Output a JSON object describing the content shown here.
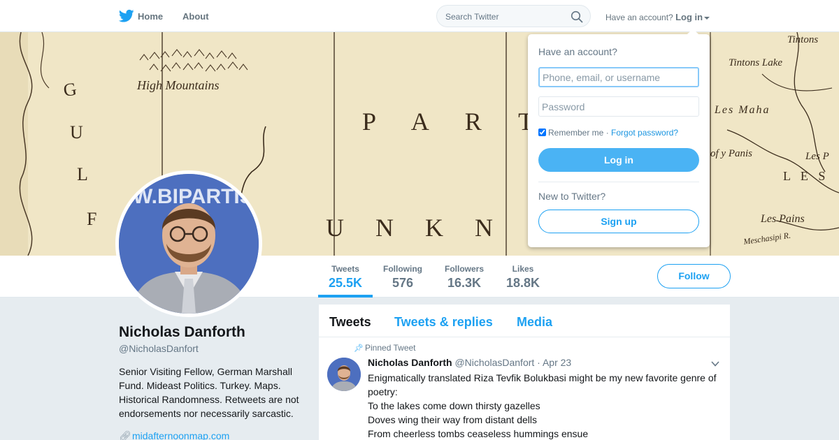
{
  "nav": {
    "logo_icon": "twitter-bird-icon",
    "home_label": "Home",
    "about_label": "About",
    "search_placeholder": "Search Twitter",
    "have_account_text": "Have an account?",
    "login_label": "Log in"
  },
  "banner": {
    "map_labels": [
      "High Mountains",
      "P A R T",
      "U N K N",
      "G",
      "U",
      "L",
      "F",
      "Tintons",
      "Tintons Lake",
      "Les Maha",
      "of y Panis",
      "Les P",
      "L E S",
      "Les Pains",
      "Meschasipi R."
    ]
  },
  "profile_nav": {
    "stats": [
      {
        "label": "Tweets",
        "value": "25.5K"
      },
      {
        "label": "Following",
        "value": "576"
      },
      {
        "label": "Followers",
        "value": "16.3K"
      },
      {
        "label": "Likes",
        "value": "18.8K"
      }
    ],
    "follow_label": "Follow"
  },
  "profile": {
    "name": "Nicholas Danforth",
    "handle": "@NicholasDanfort",
    "bio": "Senior Visiting Fellow, German Marshall Fund. Mideast Politics. Turkey. Maps. Historical Randomness. Retweets are not endorsements nor necessarily sarcastic.",
    "link": "midafternoonmap.com",
    "avatar_backdrop_text": "W.BIPARTIS"
  },
  "timeline": {
    "tabs": [
      "Tweets",
      "Tweets & replies",
      "Media"
    ],
    "pinned_label": "Pinned Tweet",
    "tweet": {
      "name": "Nicholas Danforth",
      "handle": "@NicholasDanfort",
      "date": "· Apr 23",
      "lines": [
        "Enigmatically translated Riza Tevfik Bolukbasi might be my new favorite genre of",
        "poetry:",
        "To the lakes come down thirsty gazelles",
        "Doves wing their way from distant dells",
        "From cheerless tombs ceaseless hummings ensue"
      ]
    }
  },
  "login_dropdown": {
    "header": "Have an account?",
    "username_placeholder": "Phone, email, or username",
    "password_placeholder": "Password",
    "remember_label": "Remember me ·",
    "forgot_label": "Forgot password?",
    "login_button": "Log in",
    "new_text": "New to Twitter?",
    "signup_button": "Sign up"
  },
  "colors": {
    "accent": "#1da1f2",
    "login_button": "#4ab3f4",
    "background": "#e6ecf0",
    "map_parchment": "#efe4c2"
  }
}
